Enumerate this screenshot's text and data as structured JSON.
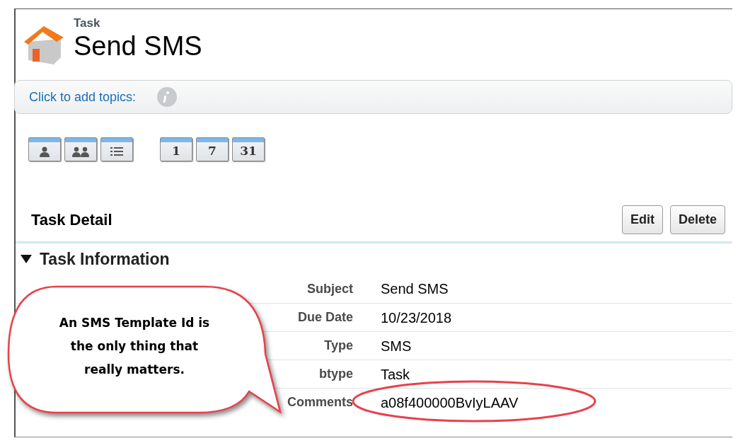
{
  "header": {
    "object_type": "Task",
    "title": "Send SMS"
  },
  "topics": {
    "label": "Click to add topics:"
  },
  "view_buttons": [
    {
      "kind": "person"
    },
    {
      "kind": "people"
    },
    {
      "kind": "list"
    },
    {
      "kind": "calendar",
      "label": "1"
    },
    {
      "kind": "calendar",
      "label": "7"
    },
    {
      "kind": "calendar",
      "label": "31"
    }
  ],
  "detail": {
    "title": "Task Detail",
    "buttons": [
      "Edit",
      "Delete"
    ],
    "section": {
      "title": "Task Information",
      "expanded": true
    },
    "fields": [
      {
        "label": "Subject",
        "value": "Send SMS",
        "highlighted": false
      },
      {
        "label": "Due Date",
        "value": "10/23/2018",
        "highlighted": false
      },
      {
        "label": "Type",
        "value": "SMS",
        "highlighted": false
      },
      {
        "label": "btype",
        "value": "Task",
        "highlighted": false
      },
      {
        "label": "Comments",
        "value": "a08f400000BvIyLAAV",
        "highlighted": true
      }
    ]
  },
  "callout": {
    "text": "An SMS Template Id is the only thing that really matters."
  }
}
